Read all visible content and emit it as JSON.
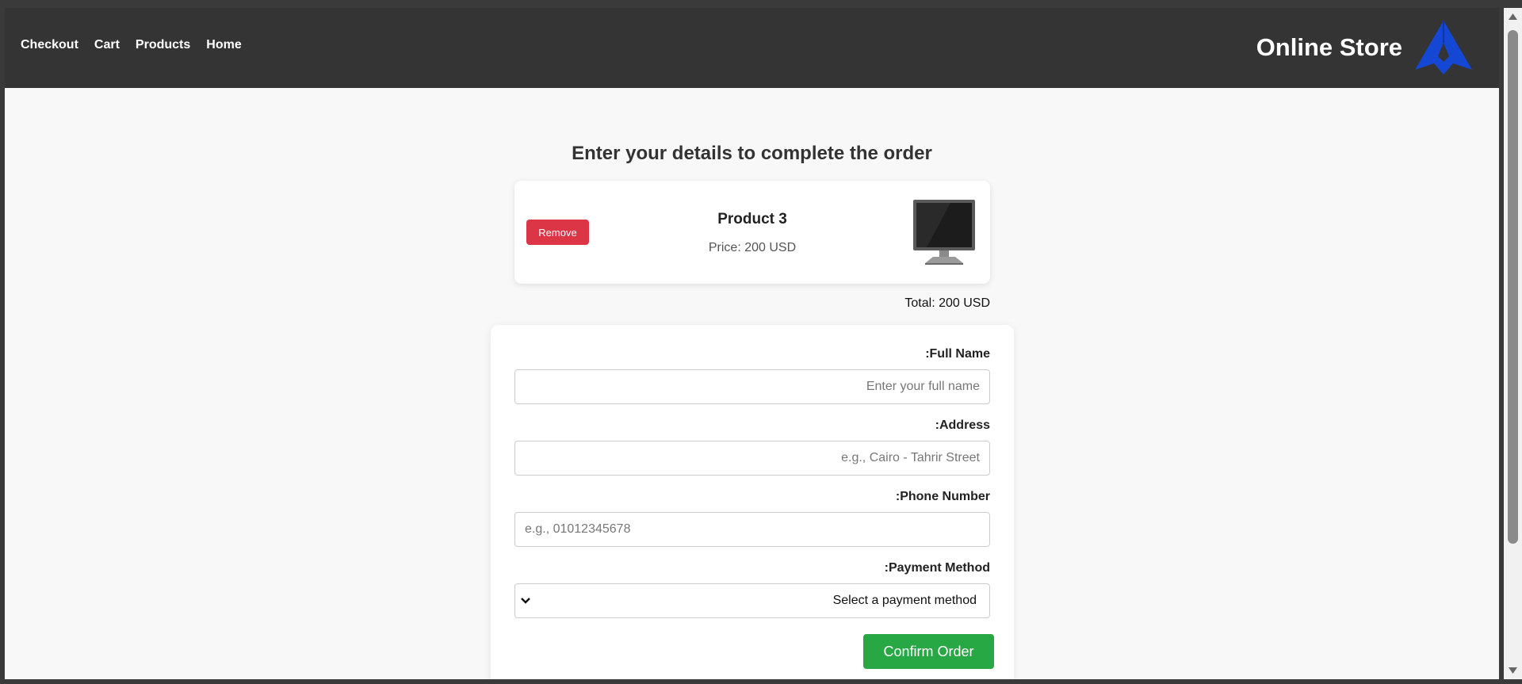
{
  "nav": {
    "links": [
      "Checkout",
      "Cart",
      "Products",
      "Home"
    ],
    "brand": "Online Store",
    "logo_icon": "store-logo-icon",
    "logo_color": "#1447d4"
  },
  "page": {
    "heading": "Enter your details to complete the order"
  },
  "cart": {
    "item": {
      "remove_label": "Remove",
      "name": "Product 3",
      "price": "Price: 200 USD",
      "image_icon": "monitor-icon"
    },
    "total": "Total: 200 USD"
  },
  "form": {
    "full_name": {
      "label": ":Full Name",
      "placeholder": "Enter your full name",
      "value": ""
    },
    "address": {
      "label": ":Address",
      "placeholder": "e.g., Cairo - Tahrir Street",
      "value": ""
    },
    "phone": {
      "label": ":Phone Number",
      "placeholder": "e.g., 01012345678",
      "value": ""
    },
    "payment": {
      "label": ":Payment Method",
      "selected": "Select a payment method"
    },
    "confirm_label": "Confirm Order"
  },
  "colors": {
    "navbar": "#343434",
    "remove": "#dc3545",
    "confirm": "#28a745",
    "accent": "#1447d4"
  }
}
